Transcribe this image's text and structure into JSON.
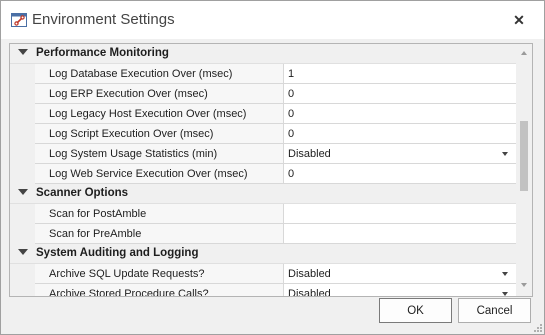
{
  "window": {
    "title": "Environment Settings",
    "icon": "settings-window-icon",
    "close_icon": "close-icon"
  },
  "grid": {
    "rows": [
      {
        "type": "category",
        "label": "Performance Monitoring"
      },
      {
        "type": "property",
        "name": "Log Database Execution Over (msec)",
        "value": "1",
        "dropdown": false
      },
      {
        "type": "property",
        "name": "Log ERP Execution Over (msec)",
        "value": "0",
        "dropdown": false
      },
      {
        "type": "property",
        "name": "Log Legacy Host Execution Over (msec)",
        "value": "0",
        "dropdown": false
      },
      {
        "type": "property",
        "name": "Log Script Execution Over (msec)",
        "value": "0",
        "dropdown": false
      },
      {
        "type": "property",
        "name": "Log System Usage Statistics (min)",
        "value": "Disabled",
        "dropdown": true
      },
      {
        "type": "property",
        "name": "Log Web Service Execution Over (msec)",
        "value": "0",
        "dropdown": false
      },
      {
        "type": "category",
        "label": "Scanner Options"
      },
      {
        "type": "property",
        "name": "Scan for PostAmble",
        "value": "",
        "dropdown": false
      },
      {
        "type": "property",
        "name": "Scan for PreAmble",
        "value": "",
        "dropdown": false
      },
      {
        "type": "category",
        "label": "System Auditing and Logging"
      },
      {
        "type": "property",
        "name": "Archive SQL Update Requests?",
        "value": "Disabled",
        "dropdown": true
      },
      {
        "type": "property",
        "name": "Archive Stored Procedure Calls?",
        "value": "Disabled",
        "dropdown": true
      }
    ]
  },
  "buttons": {
    "ok": "OK",
    "cancel": "Cancel"
  }
}
